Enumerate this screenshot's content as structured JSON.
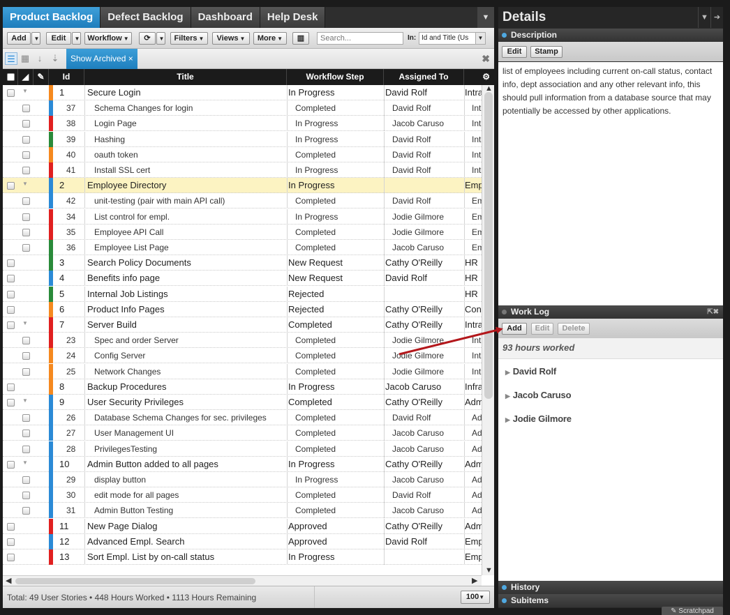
{
  "tabs": [
    {
      "label": "Product Backlog",
      "active": true
    },
    {
      "label": "Defect Backlog"
    },
    {
      "label": "Dashboard"
    },
    {
      "label": "Help Desk"
    }
  ],
  "toolbar": {
    "add": "Add",
    "edit": "Edit",
    "workflow": "Workflow",
    "filters": "Filters",
    "views": "Views",
    "more": "More",
    "search_placeholder": "Search...",
    "in_label": "In:",
    "in_value": "Id and Title (Us"
  },
  "viewbar": {
    "show_archived": "Show Archived",
    "close": "✖"
  },
  "columns": {
    "id": "Id",
    "title": "Title",
    "workflow": "Workflow Step",
    "assigned": "Assigned To"
  },
  "rows": [
    {
      "id": "1",
      "title": "Secure Login",
      "step": "In Progress",
      "assigned": "David Rolf",
      "extra": "Intra",
      "color": "#f5891f",
      "parent": true,
      "expand": true
    },
    {
      "id": "37",
      "title": "Schema Changes for login",
      "step": "Completed",
      "assigned": "David Rolf",
      "extra": "Int",
      "color": "#2b8ad6"
    },
    {
      "id": "38",
      "title": "Login Page",
      "step": "In Progress",
      "assigned": "Jacob Caruso",
      "extra": "Int",
      "color": "#e02020"
    },
    {
      "id": "39",
      "title": "Hashing",
      "step": "In Progress",
      "assigned": "David Rolf",
      "extra": "Int",
      "color": "#2a8a3a"
    },
    {
      "id": "40",
      "title": "oauth token",
      "step": "Completed",
      "assigned": "David Rolf",
      "extra": "Int",
      "color": "#f5891f"
    },
    {
      "id": "41",
      "title": "Install SSL cert",
      "step": "In Progress",
      "assigned": "David Rolf",
      "extra": "Int",
      "color": "#e02020"
    },
    {
      "id": "2",
      "title": "Employee Directory",
      "step": "In Progress",
      "assigned": "",
      "extra": "Emp",
      "color": "#2b8ad6",
      "parent": true,
      "expand": true,
      "selected": true
    },
    {
      "id": "42",
      "title": "unit-testing (pair with main API call)",
      "step": "Completed",
      "assigned": "David Rolf",
      "extra": "Em",
      "color": "#2b8ad6"
    },
    {
      "id": "34",
      "title": "List control for empl.",
      "step": "In Progress",
      "assigned": "Jodie Gilmore",
      "extra": "Em",
      "color": "#e02020"
    },
    {
      "id": "35",
      "title": "Employee API Call",
      "step": "Completed",
      "assigned": "Jodie Gilmore",
      "extra": "Em",
      "color": "#e02020"
    },
    {
      "id": "36",
      "title": "Employee List Page",
      "step": "Completed",
      "assigned": "Jacob Caruso",
      "extra": "Em",
      "color": "#2a8a3a"
    },
    {
      "id": "3",
      "title": "Search Policy Documents",
      "step": "New Request",
      "assigned": "Cathy O'Reilly",
      "extra": "HR",
      "color": "#2a8a3a",
      "parent": true
    },
    {
      "id": "4",
      "title": "Benefits info page",
      "step": "New Request",
      "assigned": "David Rolf",
      "extra": "HR",
      "color": "#2b8ad6",
      "parent": true
    },
    {
      "id": "5",
      "title": "Internal Job Listings",
      "step": "Rejected",
      "assigned": "",
      "extra": "HR",
      "color": "#2a8a3a",
      "parent": true
    },
    {
      "id": "6",
      "title": "Product Info Pages",
      "step": "Rejected",
      "assigned": "Cathy O'Reilly",
      "extra": "Con",
      "color": "#f5891f",
      "parent": true
    },
    {
      "id": "7",
      "title": "Server Build",
      "step": "Completed",
      "assigned": "Cathy O'Reilly",
      "extra": "Intra",
      "color": "#e02020",
      "parent": true,
      "expand": true
    },
    {
      "id": "23",
      "title": "Spec and order Server",
      "step": "Completed",
      "assigned": "Jodie Gilmore",
      "extra": "Int",
      "color": "#e02020"
    },
    {
      "id": "24",
      "title": "Config Server",
      "step": "Completed",
      "assigned": "Jodie Gilmore",
      "extra": "Int",
      "color": "#f5891f"
    },
    {
      "id": "25",
      "title": "Network Changes",
      "step": "Completed",
      "assigned": "Jodie Gilmore",
      "extra": "Int",
      "color": "#f5891f"
    },
    {
      "id": "8",
      "title": "Backup Procedures",
      "step": "In Progress",
      "assigned": "Jacob Caruso",
      "extra": "Infra",
      "color": "#f5891f",
      "parent": true
    },
    {
      "id": "9",
      "title": "User Security Privileges",
      "step": "Completed",
      "assigned": "Cathy O'Reilly",
      "extra": "Adm",
      "color": "#2b8ad6",
      "parent": true,
      "expand": true
    },
    {
      "id": "26",
      "title": "Database Schema Changes for sec. privileges",
      "step": "Completed",
      "assigned": "David Rolf",
      "extra": "Ad",
      "color": "#2b8ad6"
    },
    {
      "id": "27",
      "title": "User Management UI",
      "step": "Completed",
      "assigned": "Jacob Caruso",
      "extra": "Ad",
      "color": "#2b8ad6"
    },
    {
      "id": "28",
      "title": "PrivilegesTesting",
      "step": "Completed",
      "assigned": "Jacob Caruso",
      "extra": "Ad",
      "color": "#2b8ad6"
    },
    {
      "id": "10",
      "title": "Admin Button added to all pages",
      "step": "In Progress",
      "assigned": "Cathy O'Reilly",
      "extra": "Adm",
      "color": "#2b8ad6",
      "parent": true,
      "expand": true
    },
    {
      "id": "29",
      "title": "display button",
      "step": "In Progress",
      "assigned": "Jacob Caruso",
      "extra": "Ad",
      "color": "#2b8ad6"
    },
    {
      "id": "30",
      "title": "edit mode for all pages",
      "step": "Completed",
      "assigned": "David Rolf",
      "extra": "Ad",
      "color": "#2b8ad6"
    },
    {
      "id": "31",
      "title": "Admin Button Testing",
      "step": "Completed",
      "assigned": "Jacob Caruso",
      "extra": "Ad",
      "color": "#2b8ad6"
    },
    {
      "id": "11",
      "title": "New Page Dialog",
      "step": "Approved",
      "assigned": "Cathy O'Reilly",
      "extra": "Adm",
      "color": "#e02020",
      "parent": true
    },
    {
      "id": "12",
      "title": "Advanced Empl. Search",
      "step": "Approved",
      "assigned": "David Rolf",
      "extra": "Emp",
      "color": "#2b8ad6",
      "parent": true
    },
    {
      "id": "13",
      "title": "Sort Empl. List by on-call status",
      "step": "In Progress",
      "assigned": "",
      "extra": "Emp",
      "color": "#e02020",
      "parent": true
    }
  ],
  "status": {
    "text": "Total: 49 User Stories • 448 Hours Worked • 1113 Hours Remaining",
    "page_size": "100"
  },
  "details": {
    "title": "Details",
    "description_header": "Description",
    "edit": "Edit",
    "stamp": "Stamp",
    "description_text": "list of employees including current on-call status, contact info, dept association and any other relevant info, this should pull information from a database source that may potentially be accessed by other applications.",
    "worklog_header": "Work Log",
    "wl_add": "Add",
    "wl_edit": "Edit",
    "wl_delete": "Delete",
    "hours": "93 hours worked",
    "people": [
      "David Rolf",
      "Jacob Caruso",
      "Jodie Gilmore"
    ],
    "history_header": "History",
    "subitems_header": "Subitems"
  },
  "scratchpad": "Scratchpad",
  "colors": {
    "accent": "#2b8ad6",
    "selected_row": "#fcf3c2",
    "arrow": "#b3171b"
  }
}
